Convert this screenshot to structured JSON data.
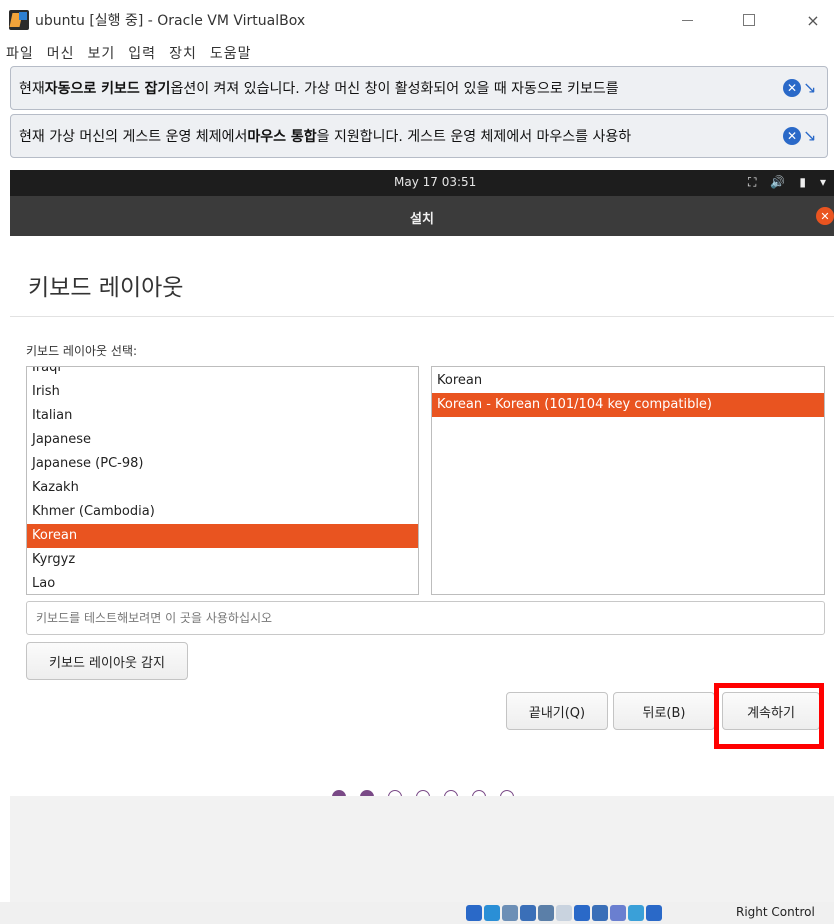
{
  "window": {
    "title": "ubuntu [실행 중] - Oracle VM VirtualBox",
    "controls": {
      "minimize": "minimize-icon",
      "maximize": "maximize-icon",
      "close": "×"
    }
  },
  "menu": [
    "파일",
    "머신",
    "보기",
    "입력",
    "장치",
    "도움말"
  ],
  "notices": [
    {
      "pre": "현재 ",
      "bold1": "자동으로 키보드 잡기",
      "mid": " 옵션이 켜져 있습니다. 가상 머신 창이 활성화되어 있을 때 자동으로 키보드를",
      "icons": [
        "close-notice-icon",
        "info-arrow-icon"
      ]
    },
    {
      "pre": "현재 가상 머신의 게스트 운영 체제에서 ",
      "bold1": "마우스 통합",
      "mid": "을 지원합니다. 게스트 운영 체제에서 마우스를 사용하",
      "icons": [
        "close-notice-icon",
        "info-arrow-icon"
      ]
    }
  ],
  "guest": {
    "clock": "May 17  03:51",
    "tray_icons": [
      "network-icon",
      "volume-icon",
      "battery-icon",
      "menu-arrow-icon"
    ],
    "header_title": "설치",
    "heading": "키보드 레이아웃",
    "section_label": "키보드 레이아웃 선택:",
    "layouts": [
      "Iraqi",
      "Irish",
      "Italian",
      "Japanese",
      "Japanese (PC-98)",
      "Kazakh",
      "Khmer (Cambodia)",
      "Korean",
      "Kyrgyz",
      "Lao"
    ],
    "selected_layout": "Korean",
    "variants": [
      "Korean",
      "Korean - Korean (101/104 key compatible)"
    ],
    "selected_variant": "Korean - Korean (101/104 key compatible)",
    "test_placeholder": "키보드를 테스트해보려면 이 곳을 사용하십시오",
    "detect_button": "키보드 레이아웃 감지",
    "quit_button": "끝내기(Q)",
    "back_button": "뒤로(B)",
    "continue_button": "계속하기",
    "progress": {
      "total_steps": 7,
      "completed_steps": 2
    }
  },
  "statusbar": {
    "host_key": "Right Control",
    "icons": [
      "hdd-icon",
      "optical-drive-icon",
      "audio-icon",
      "network-adapter-icon",
      "usb-icon",
      "shared-folder-icon",
      "display-icon",
      "recording-icon",
      "vm-icon",
      "mouse-integration-icon",
      "keyboard-capture-icon"
    ]
  },
  "colors": {
    "ubuntu_orange": "#e95420",
    "highlight_red": "#ff0000",
    "progress_dot": "#7a4a87",
    "topbar_dark": "#1d1d1d",
    "headerbar": "#3b3b3b"
  }
}
